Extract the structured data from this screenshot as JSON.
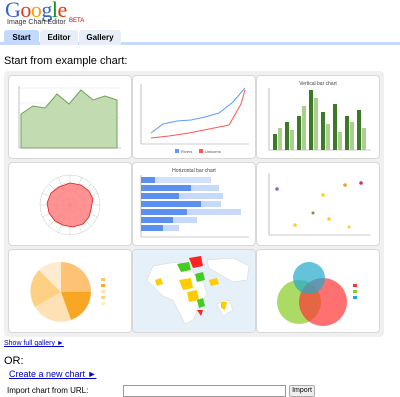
{
  "logo": {
    "letters": [
      {
        "ch": "G",
        "color": "#3366cc"
      },
      {
        "ch": "o",
        "color": "#dc3912"
      },
      {
        "ch": "o",
        "color": "#ff9900"
      },
      {
        "ch": "g",
        "color": "#3366cc"
      },
      {
        "ch": "l",
        "color": "#109618"
      },
      {
        "ch": "e",
        "color": "#dc3912"
      }
    ],
    "subtitle": "Image Chart Editor",
    "badge": "BETA"
  },
  "tabs": {
    "start": "Start",
    "editor": "Editor",
    "gallery": "Gallery"
  },
  "examples": {
    "title": "Start from example chart:",
    "thumbnails": {
      "area": {
        "type": "area",
        "fill": "#c2dbb0",
        "stroke": "#6fa356",
        "values": [
          45,
          55,
          52,
          70,
          58,
          75,
          62,
          65
        ]
      },
      "line": {
        "type": "line",
        "legend": [
          "Rivers",
          "Unicorns"
        ],
        "colors": [
          "#5d9bff",
          "#ff5555"
        ]
      },
      "vbar": {
        "type": "bar",
        "title": "Vertical bar chart",
        "colors": [
          "#3c7a27",
          "#a9d18e"
        ]
      },
      "radar": {
        "type": "radar",
        "fill": "#ff8080",
        "stroke": "#dd2222"
      },
      "hbar": {
        "type": "bar",
        "title": "Horizontal bar chart",
        "colors": [
          "#5b8ff0",
          "#c6d9fb"
        ]
      },
      "scatter": {
        "type": "scatter"
      },
      "pie": {
        "type": "pie",
        "colors": [
          "#f9a625",
          "#fdc274",
          "#ffe1b6",
          "#ffcf83",
          "#ffebcf"
        ]
      },
      "map": {
        "type": "map",
        "ocean": "#e5f0f8",
        "land": "#ffffff",
        "highlights": [
          "#ff2222",
          "#ffcc00",
          "#44cc22"
        ]
      },
      "venn": {
        "type": "venn",
        "colors": [
          "#22aacc",
          "#88cc22",
          "#ff3333"
        ]
      }
    }
  },
  "show_gallery_link": "Show full gallery ►",
  "or_text": "OR:",
  "create_link": "Create a new chart ►",
  "import": {
    "label": "Import chart from URL:",
    "value": "",
    "button": "Import"
  }
}
